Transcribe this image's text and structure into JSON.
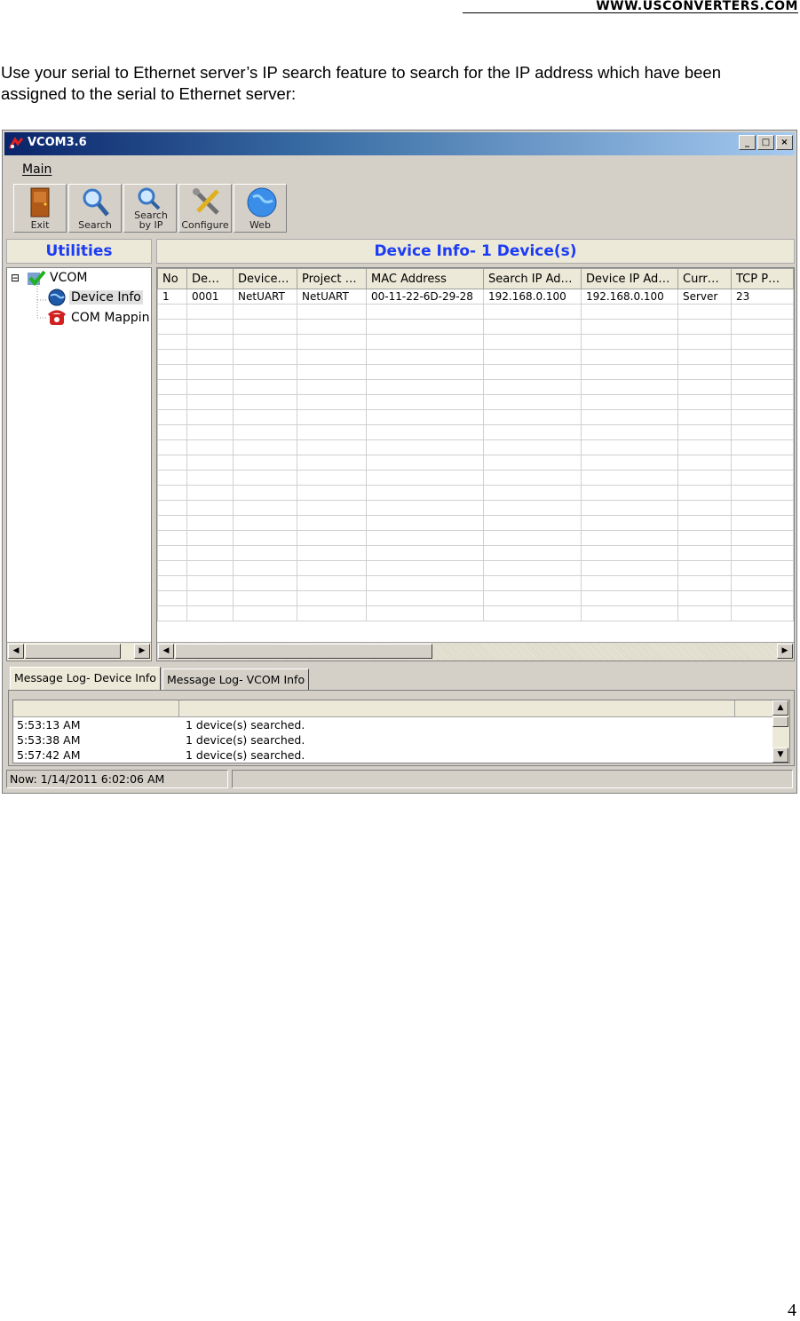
{
  "header": {
    "site": "WWW.USCONVERTERS.COM"
  },
  "intro_text": "Use your serial to Ethernet server’s IP search feature to search for the IP address which have been assigned to the serial to Ethernet server:",
  "page_number": "4",
  "window": {
    "title": "VCOM3.6",
    "controls": {
      "minimize": "_",
      "maximize": "□",
      "close": "×"
    }
  },
  "menu": {
    "main": "Main"
  },
  "toolbar": [
    {
      "label": "Exit",
      "icon": "exit-door-icon"
    },
    {
      "label": "Search",
      "icon": "magnifier-icon"
    },
    {
      "label": "Search by IP",
      "icon": "search-by-ip-icon"
    },
    {
      "label": "Configure",
      "icon": "tools-icon"
    },
    {
      "label": "Web",
      "icon": "globe-icon"
    }
  ],
  "utilities": {
    "title": "Utilities",
    "tree": {
      "expander": "⊟",
      "root": "VCOM",
      "children": [
        "Device Info",
        "COM Mappin"
      ]
    }
  },
  "device_info": {
    "title": "Device Info- 1 Device(s)",
    "columns": [
      "No",
      "De…",
      "Device…",
      "Project …",
      "MAC Address",
      "Search IP Ad…",
      "Device IP Ad…",
      "Curr…",
      "TCP P…"
    ],
    "rows": [
      [
        "1",
        "0001",
        "NetUART",
        "NetUART",
        "00-11-22-6D-29-28",
        "192.168.0.100",
        "192.168.0.100",
        "Server",
        "23"
      ]
    ]
  },
  "message_log": {
    "tabs": [
      "Message Log- Device Info",
      "Message Log- VCOM Info"
    ],
    "entries": [
      {
        "time": "5:53:13 AM",
        "message": "1 device(s) searched."
      },
      {
        "time": "5:53:38 AM",
        "message": "1 device(s) searched."
      },
      {
        "time": "5:57:42 AM",
        "message": "1 device(s) searched."
      }
    ]
  },
  "status": {
    "now": "Now: 1/14/2011 6:02:06 AM"
  },
  "colors": {
    "accent_blue": "#1c3cf4",
    "titlebar": "#0a246a",
    "window_bg": "#d4d0c8"
  }
}
